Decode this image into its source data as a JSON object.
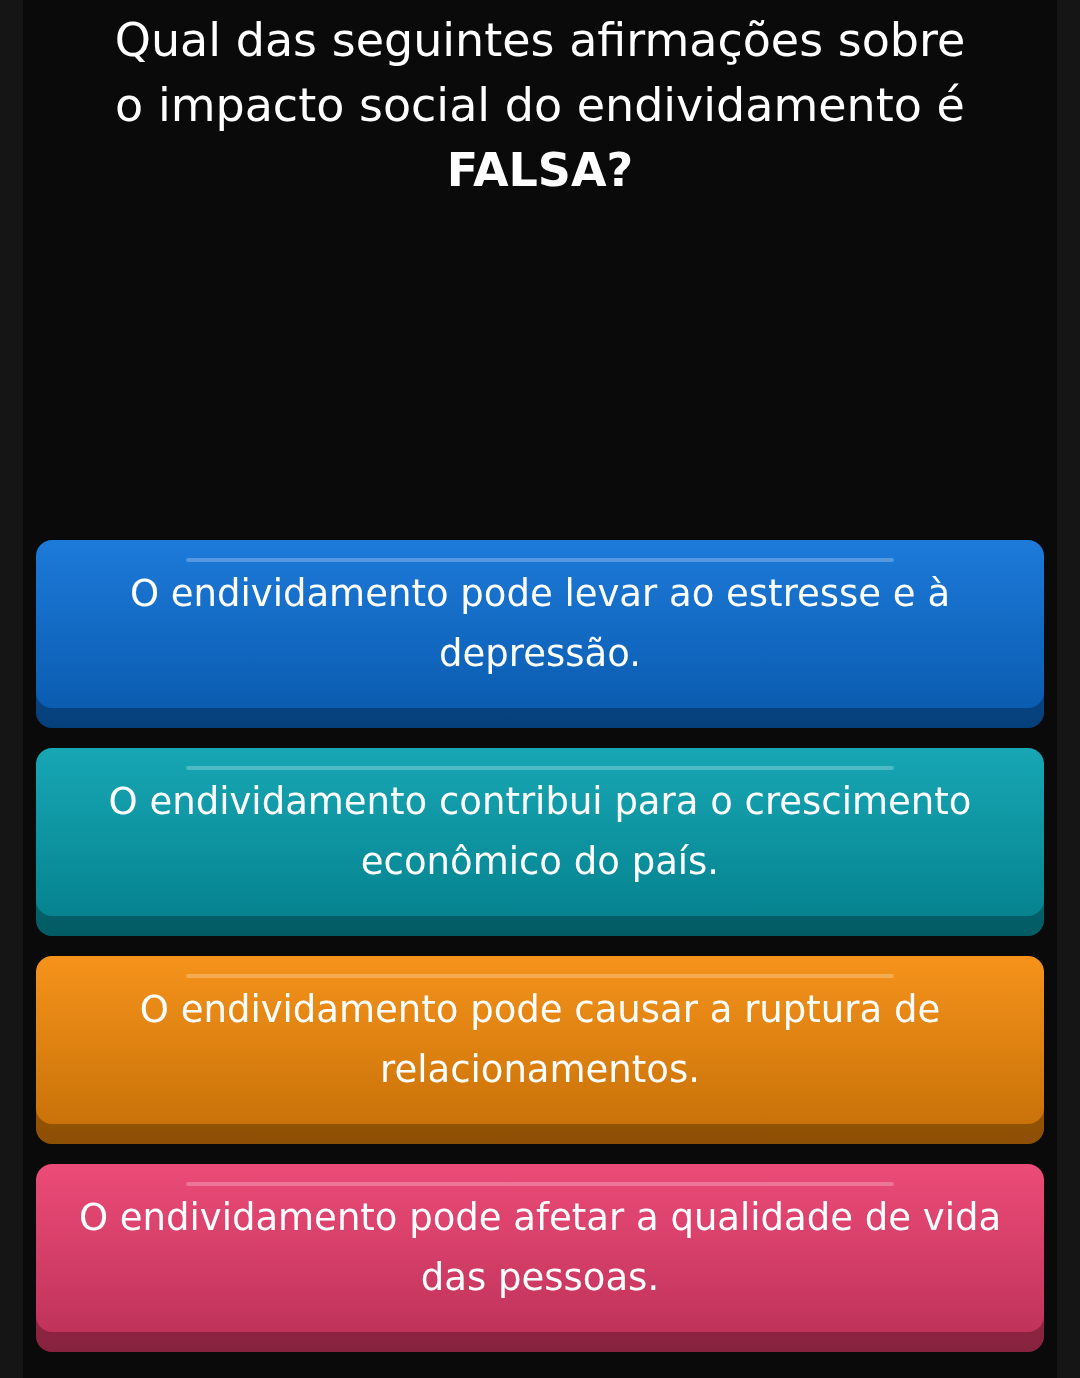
{
  "question": "Qual das seguintes afirmações sobre o impacto social do endividamento é **FALSA?**",
  "options": [
    {
      "text": "O endividamento pode levar ao estresse e à depressão.",
      "color": "#0a6fd6"
    },
    {
      "text": "O endividamento contribui para o crescimento econômico do país.",
      "color": "#049fae"
    },
    {
      "text": "O endividamento pode causar a ruptura de relacionamentos.",
      "color": "#f58a08"
    },
    {
      "text": "O endividamento pode afetar a qualidade de vida das pessoas.",
      "color": "#ea3c6c"
    }
  ]
}
